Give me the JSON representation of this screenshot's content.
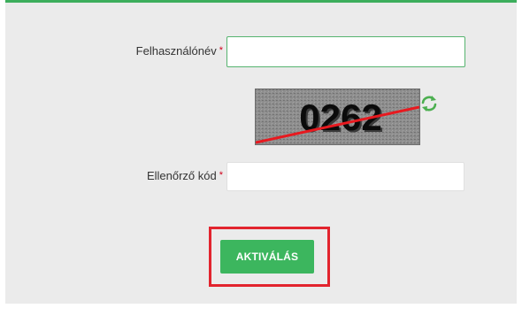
{
  "form": {
    "username_label": "Felhasználónév",
    "username_value": "",
    "code_label": "Ellenőrző kód",
    "code_value": "",
    "required_marker": "*"
  },
  "captcha": {
    "text": "0262",
    "refresh_icon": "refresh-icon"
  },
  "actions": {
    "activate_label": "AKTIVÁLÁS"
  },
  "colors": {
    "accent": "#3cb65e",
    "panel_bg": "#ebebeb",
    "required": "#d0021b",
    "highlight": "#e2242e"
  }
}
